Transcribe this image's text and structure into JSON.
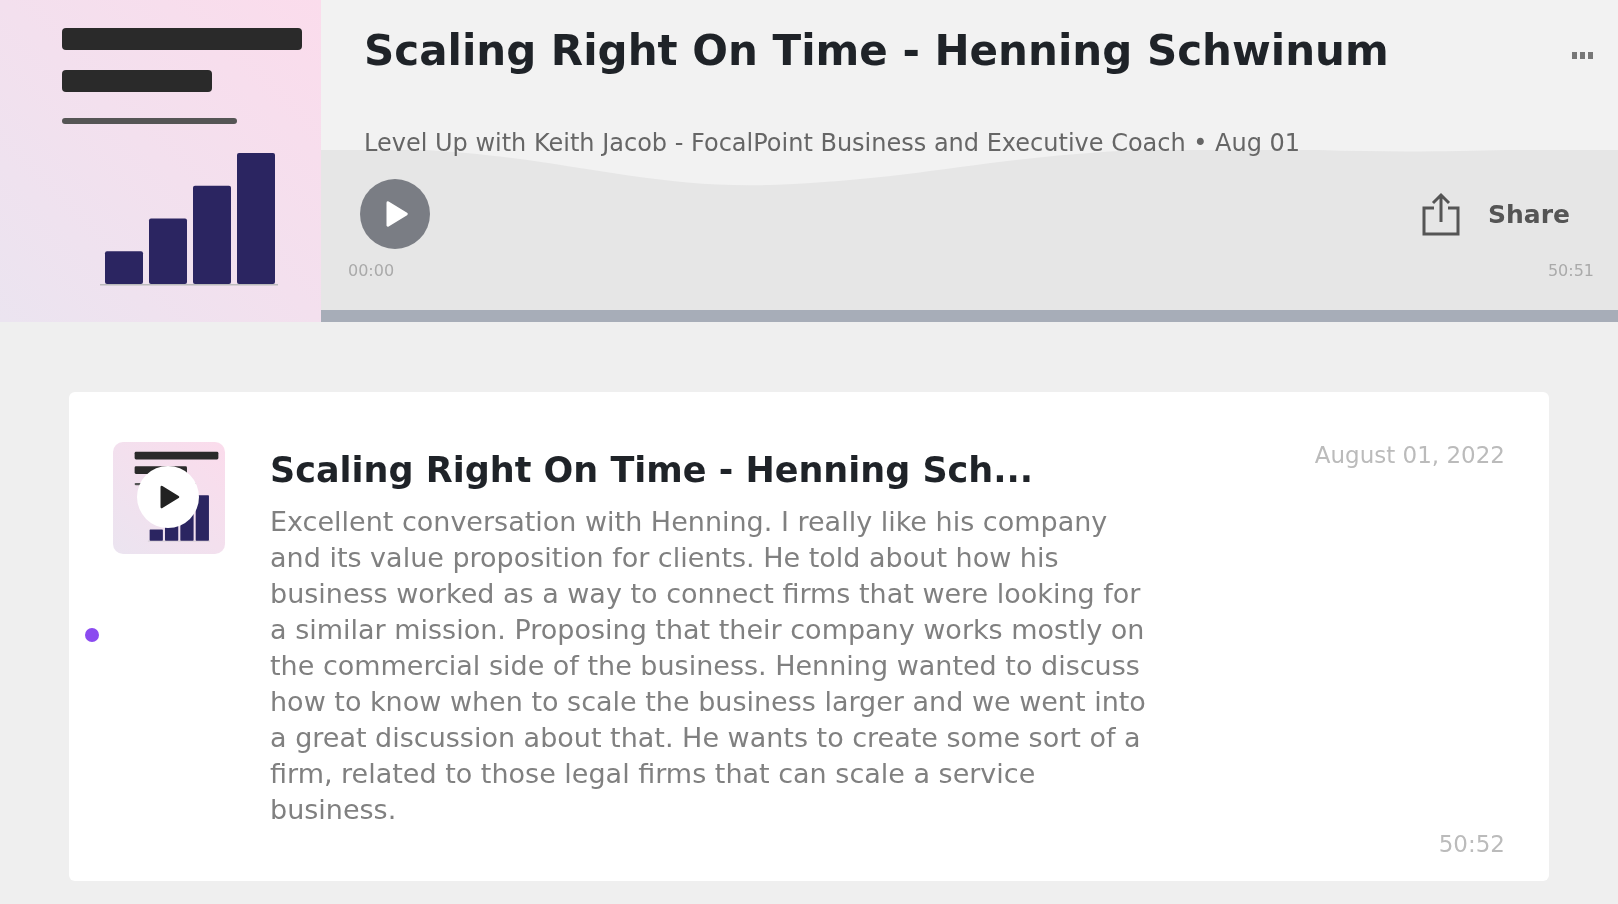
{
  "header": {
    "title": "Scaling Right On Time - Henning Schwinum",
    "subtitle": "Level Up with Keith Jacob - FocalPoint Business and Executive Coach • Aug 01",
    "elapsed": "00:00",
    "duration": "50:51",
    "share_label": "Share",
    "playing": false
  },
  "episodes": [
    {
      "title": "Scaling Right On Time - Henning Sch...",
      "description": "Excellent conversation with Henning. I really like his company and its value proposition for clients. He told about how his business worked as a way to connect firms that were looking for a similar mission.  Proposing that their company works mostly on the commercial side of the business. Henning wanted to discuss how to know when to scale the business larger and we went into a great discussion about that. He wants to create some sort of a firm, related to those legal firms that can scale a service business.",
      "date": "August 01, 2022",
      "duration": "50:52",
      "unplayed": true,
      "color": "#8b4bf0"
    }
  ]
}
